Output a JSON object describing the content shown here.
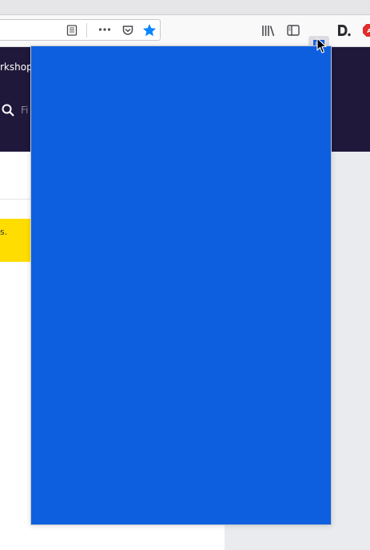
{
  "browser": {
    "toolbar": {
      "reader_icon": "reader-view-icon",
      "more_icon": "more-actions-icon",
      "pocket_icon": "pocket-icon",
      "bookmark_icon": "bookmark-star-icon",
      "library_icon": "library-icon",
      "sidebar_icon": "sidebar-icon",
      "bitwarden_icon": "bitwarden-shield-icon",
      "d_icon": "dashlane-icon",
      "adblock_icon": "adblock-icon"
    }
  },
  "page": {
    "nav_partial": "rkshop",
    "search_placeholder": "Fi",
    "banner_partial": "s."
  },
  "popup": {},
  "colors": {
    "popup_bg": "#0d5fdf",
    "header_bg": "#20183a",
    "banner_bg": "#ffdd00",
    "bookmark_star": "#0a84ff"
  }
}
